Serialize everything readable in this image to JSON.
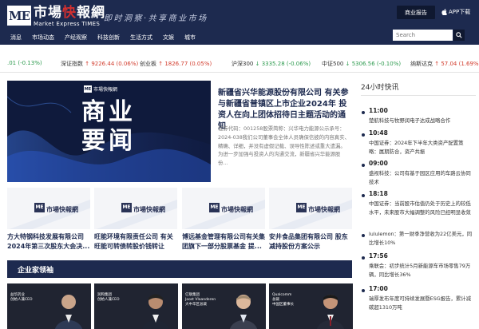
{
  "header": {
    "logo_mark": "ME",
    "logo_cn_a": "市場",
    "logo_cn_fast": "快",
    "logo_cn_b": "報網",
    "logo_en": "Market Express TIMES",
    "slogan": "即时洞察·共享商业市场",
    "report_label": "商业报告",
    "app_label": "APP下载",
    "search_placeholder": "Search",
    "nav": [
      "消息",
      "市场动态",
      "产经观察",
      "科技创新",
      "生活方式",
      "文娱",
      "城市"
    ]
  },
  "ticker": [
    {
      "name": "",
      "value": ".01 (-0.13%)",
      "dir": "down"
    },
    {
      "name": "深证指数",
      "value": "↑ 9226.44 (0.06%)",
      "dir": "up"
    },
    {
      "name": "创业板",
      "value": "↑ 1826.77 (0.05%)",
      "dir": "up"
    },
    {
      "name": "沪深300",
      "value": "↓ 3335.28 (-0.06%)",
      "dir": "down"
    },
    {
      "name": "中证500",
      "value": "↓ 5306.56 (-0.10%)",
      "dir": "down"
    },
    {
      "name": "纳斯达克",
      "value": "↑ 57.04 (1.69%)",
      "dir": "up"
    }
  ],
  "lead": {
    "image_text": "商业\n要闻",
    "image_logo": "市場快報網",
    "title": "新疆省兴华能源股份有限公司 有关参与新疆省普镇区上市企业2024年 投资人在向上团体招待日主题活动的通知",
    "body": "证券代码：001258股票简称：兴华电力能源公示承号：2024-038我们公司董事会全体人员确保信披的内容真实、精确、详细，并没有虚假记载、误导性陈述或重大遗漏。为进一步加强与投资人的沟通交流，新疆省兴华能源股份..."
  },
  "thumbs": [
    {
      "title": "方大特钢科技发展有限公司 2024年第三次股东大会决..."
    },
    {
      "title": "旺能环境有限责任公司 有关旺能可转债转股价钱转让的..."
    },
    {
      "title": "博远基金管理有限公司有关集团旗下一部分股票基金 提..."
    },
    {
      "title": "安井食品集团有限公司 股东减持股份方案公示"
    }
  ],
  "leaders": {
    "heading": "企业家领袖",
    "items": [
      {
        "caption": "益华药业\n创始人兼CEO"
      },
      {
        "caption": "润和集团\n创始人兼CEO"
      },
      {
        "caption": "亿联集团\nJoost Vlaanderen\n大中华区总裁"
      },
      {
        "caption": "Qualcomm\n总裁\n中国区董事长"
      }
    ]
  },
  "side": {
    "title": "24小时快讯",
    "news": [
      {
        "time": "11:00",
        "text": "楚航科技与牧野润电子达成战略合作"
      },
      {
        "time": "10:48",
        "text": "中国证券：2024年下半年大类资产配置策略：属期防合，资产共振"
      },
      {
        "time": "09:00",
        "text": "盛视科技：公司有基于园区应用的车路云协同技术"
      },
      {
        "time": "18:18",
        "text": "中国证券：当前股市估值仍处于历史上的较低水平，未来股市大幅调整的风险已经明显收敛"
      },
      {
        "time": "",
        "text": "lululemon：第一财季净营收为22亿美元，同比增长10%"
      },
      {
        "time": "17:56",
        "text": "乘联会：初步统计5月新能源车市场零售79万辆，同比增长36%"
      },
      {
        "time": "17:00",
        "text": "瑞厚发布年度可持续发展暨ESG报告，累计减碳超1310万吨"
      }
    ]
  },
  "colors": {
    "navy": "#1d2a4f",
    "up": "#d23b2c",
    "down": "#2e9b4f"
  }
}
